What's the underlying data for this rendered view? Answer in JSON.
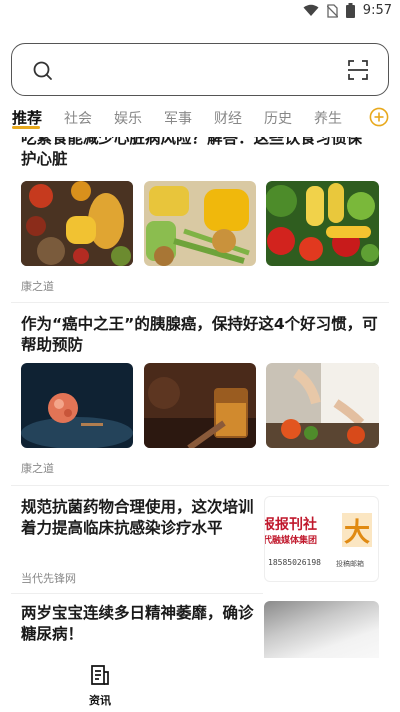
{
  "status_bar": {
    "time": "9:57"
  },
  "search": {
    "placeholder": ""
  },
  "tabs": [
    {
      "label": "推荐",
      "active": true
    },
    {
      "label": "社会"
    },
    {
      "label": "娱乐"
    },
    {
      "label": "军事"
    },
    {
      "label": "财经"
    },
    {
      "label": "历史"
    },
    {
      "label": "养生"
    }
  ],
  "articles": [
    {
      "title_line1": "吃素食能减少心脏病风险？解答：这些饮食习惯保",
      "title_line2": "护心脏",
      "source": "康之道"
    },
    {
      "title_line1": "作为“癌中之王”的胰腺癌，保持好这4个好习惯，可",
      "title_line2": "帮助预防",
      "source": "康之道"
    },
    {
      "title_line1": "规范抗菌药物合理使用，这次培训",
      "title_line2": "着力提高临床抗感染诊疗水平",
      "source": "当代先锋网",
      "thumb_text": {
        "line1": "报报刊社",
        "line2": "代融媒体集团",
        "phone": "18585026198",
        "big": "大",
        "small": "投稿邮箱"
      }
    },
    {
      "title_line1": "两岁宝宝连续多日精神萎靡，确诊",
      "title_line2": "糖尿病！"
    }
  ],
  "bottom_nav": {
    "label": "资讯"
  },
  "colors": {
    "accent": "#e8a91d",
    "active_tab": "#111111",
    "inactive_tab": "#888888",
    "thumb_red": "#c0182c"
  }
}
